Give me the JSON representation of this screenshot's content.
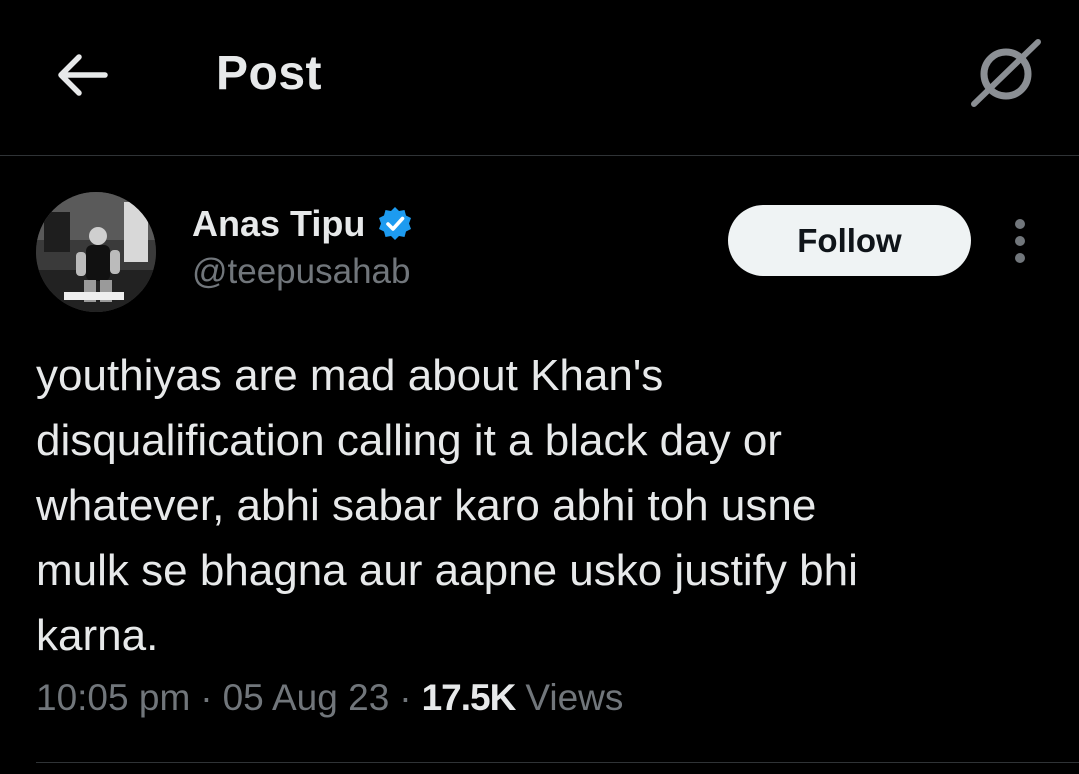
{
  "header": {
    "title": "Post",
    "back_icon": "arrow-left-icon",
    "grok_icon": "grok-slash-icon"
  },
  "author": {
    "name": "Anas Tipu",
    "handle": "@teepusahab",
    "verified": true,
    "verified_color": "#1d9bf0",
    "follow_label": "Follow"
  },
  "tweet": {
    "lines": [
      "youthiyas are mad about Khan's",
      "disqualification calling it a black day or",
      "whatever, abhi sabar karo abhi toh usne",
      "mulk se bhagna aur aapne usko justify bhi",
      "karna."
    ],
    "time": "10:05 pm",
    "date": "05 Aug 23",
    "separator": "·",
    "views_count": "17.5K",
    "views_label": "Views"
  },
  "colors": {
    "background": "#000000",
    "text": "#e7e9ea",
    "secondary": "#71767b",
    "divider": "#2f3336"
  }
}
